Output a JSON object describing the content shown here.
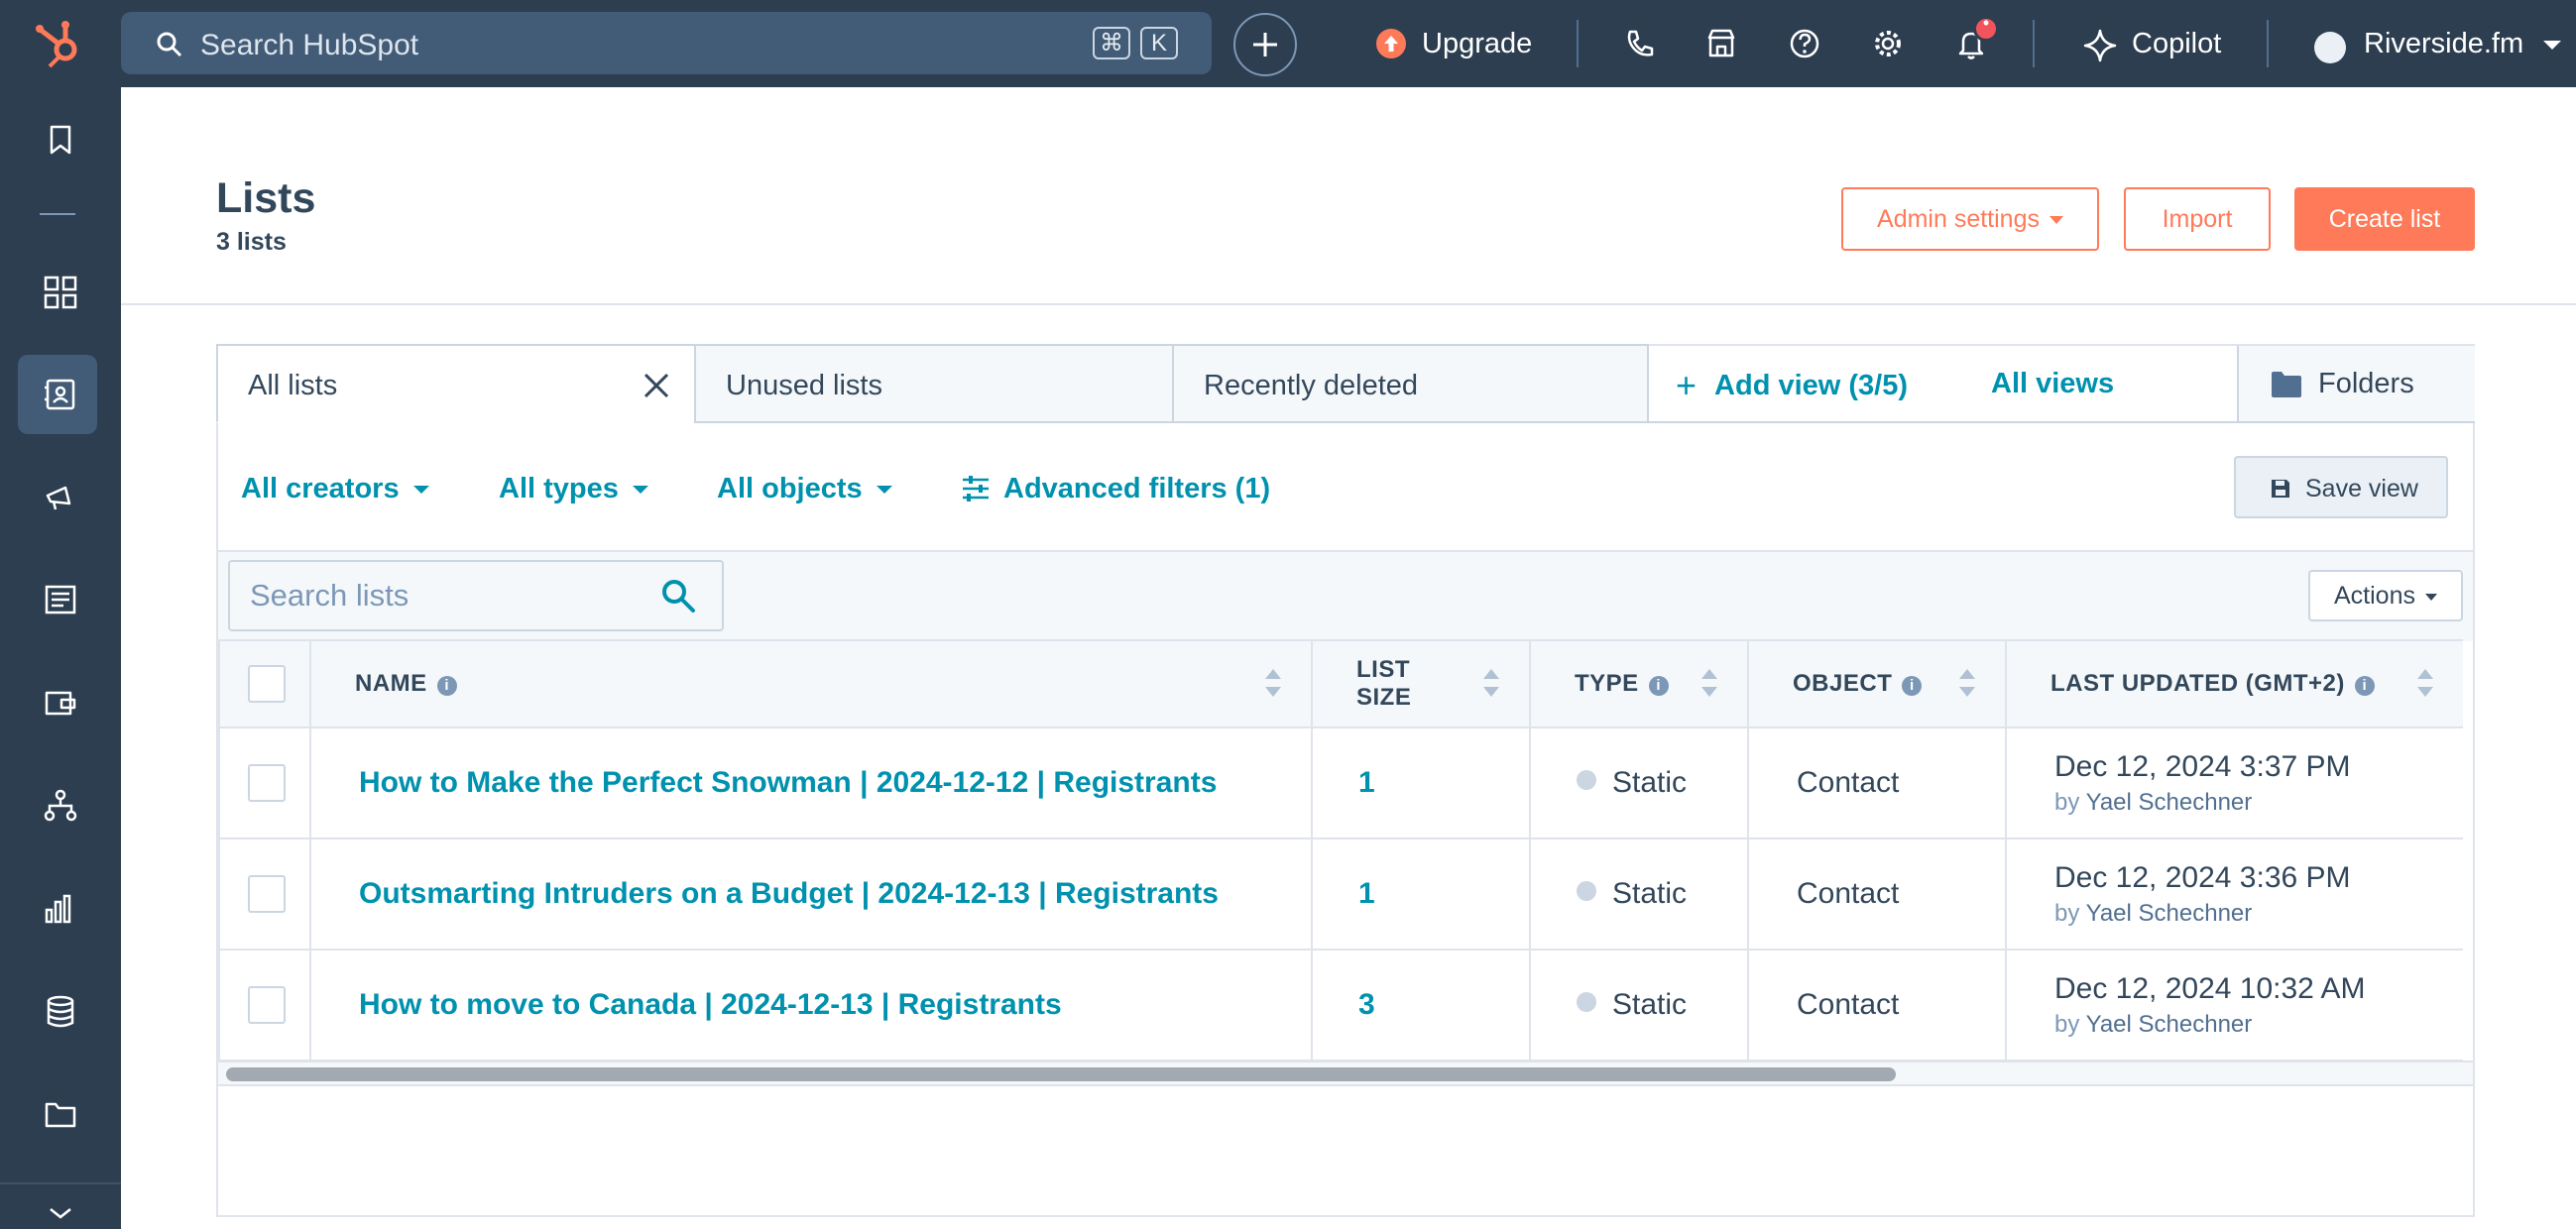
{
  "topbar": {
    "search_placeholder": "Search HubSpot",
    "kbd_cmd": "⌘",
    "kbd_key": "K",
    "upgrade_label": "Upgrade",
    "copilot_label": "Copilot",
    "account_label": "Riverside.fm",
    "notification_dot": "•"
  },
  "header": {
    "title": "Lists",
    "subtitle": "3 lists",
    "admin_settings_label": "Admin settings",
    "import_label": "Import",
    "create_list_label": "Create list"
  },
  "tabs": [
    {
      "label": "All lists",
      "active": true
    },
    {
      "label": "Unused lists",
      "active": false
    },
    {
      "label": "Recently deleted",
      "active": false
    }
  ],
  "views": {
    "add_view_label": "Add view (3/5)",
    "all_views_label": "All views",
    "folders_label": "Folders"
  },
  "filters": {
    "creators": "All creators",
    "types": "All types",
    "objects": "All objects",
    "advanced": "Advanced filters (1)",
    "save_view": "Save view"
  },
  "toolbar": {
    "search_placeholder": "Search lists",
    "actions_label": "Actions"
  },
  "table": {
    "columns": {
      "name": "NAME",
      "size_line1": "LIST",
      "size_line2": "SIZE",
      "type": "TYPE",
      "object": "OBJECT",
      "updated": "LAST UPDATED (GMT+2)"
    },
    "rows": [
      {
        "name": "How to Make the Perfect Snowman | 2024-12-12 | Registrants",
        "size": "1",
        "type": "Static",
        "object": "Contact",
        "updated": "Dec 12, 2024 3:37 PM",
        "by_prefix": "by",
        "by_name": "Yael Schechner"
      },
      {
        "name": "Outsmarting Intruders on a Budget | 2024-12-13 | Registrants",
        "size": "1",
        "type": "Static",
        "object": "Contact",
        "updated": "Dec 12, 2024 3:36 PM",
        "by_prefix": "by",
        "by_name": "Yael Schechner"
      },
      {
        "name": "How to move to Canada | 2024-12-13 | Registrants",
        "size": "3",
        "type": "Static",
        "object": "Contact",
        "updated": "Dec 12, 2024 10:32 AM",
        "by_prefix": "by",
        "by_name": "Yael Schechner"
      }
    ]
  },
  "colors": {
    "topbar": "#2d3e50",
    "accent": "#ff7a59",
    "link": "#0091ae"
  },
  "icons": {
    "nav": [
      "bookmark-icon",
      "grid-icon",
      "contacts-icon",
      "marketing-icon",
      "content-icon",
      "commerce-icon",
      "automation-icon",
      "reporting-icon",
      "data-icon",
      "library-icon",
      "collapse-icon"
    ],
    "topbar": [
      "hubspot-logo-icon",
      "search-icon",
      "plus-icon",
      "upgrade-icon",
      "phone-icon",
      "marketplace-icon",
      "help-icon",
      "settings-icon",
      "bell-icon",
      "copilot-sparkle-icon",
      "avatar-icon"
    ]
  }
}
